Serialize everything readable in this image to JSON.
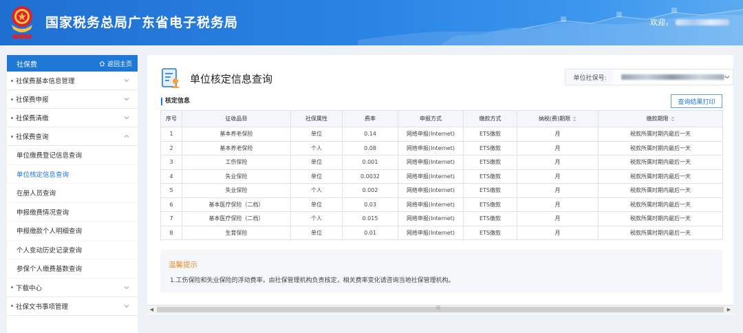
{
  "header": {
    "title": "国家税务总局广东省电子税务局",
    "welcome": "欢迎，"
  },
  "sidebar": {
    "title": "社保费",
    "home_link": "返回主页",
    "groups_top": [
      {
        "label": "社保费基本信息管理",
        "expanded": false
      },
      {
        "label": "社保费申报",
        "expanded": false
      },
      {
        "label": "社保费清缴",
        "expanded": false
      },
      {
        "label": "社保费查询",
        "expanded": true
      }
    ],
    "sub_items": [
      {
        "label": "单位缴费登记信息查询",
        "active": false
      },
      {
        "label": "单位核定信息查询",
        "active": true
      },
      {
        "label": "在册人员查询",
        "active": false
      },
      {
        "label": "申报缴费情况查询",
        "active": false
      },
      {
        "label": "申报缴款个人明细查询",
        "active": false
      },
      {
        "label": "个人变动历史记录查询",
        "active": false
      },
      {
        "label": "参保个人缴费基数查询",
        "active": false
      }
    ],
    "groups_bottom": [
      {
        "label": "下载中心",
        "expanded": false
      },
      {
        "label": "社保文书事项管理",
        "expanded": false
      }
    ]
  },
  "main": {
    "page_title": "单位核定信息查询",
    "ssn_label": "单位社保号:",
    "print_button": "查询结果打印",
    "section_label": "核定信息",
    "table": {
      "columns": [
        "序号",
        "征收品目",
        "社保属性",
        "费率",
        "申报方式",
        "缴款方式",
        "纳税(费)期限",
        "缴款期限"
      ],
      "rows": [
        [
          "1",
          "基本养老保险",
          "单位",
          "0.14",
          "网络申报(Internet)",
          "ETS缴款",
          "月",
          "税款所属时期内最后一天"
        ],
        [
          "2",
          "基本养老保险",
          "个人",
          "0.08",
          "网络申报(Internet)",
          "ETS缴款",
          "月",
          "税款所属时期内最后一天"
        ],
        [
          "3",
          "工伤保险",
          "单位",
          "0.001",
          "网络申报(Internet)",
          "ETS缴款",
          "月",
          "税款所属时期内最后一天"
        ],
        [
          "4",
          "失业保险",
          "单位",
          "0.0032",
          "网络申报(Internet)",
          "ETS缴款",
          "月",
          "税款所属时期内最后一天"
        ],
        [
          "5",
          "失业保险",
          "个人",
          "0.002",
          "网络申报(Internet)",
          "ETS缴款",
          "月",
          "税款所属时期内最后一天"
        ],
        [
          "6",
          "基本医疗保险（二档）",
          "单位",
          "0.03",
          "网络申报(Internet)",
          "ETS缴款",
          "月",
          "税款所属时期内最后一天"
        ],
        [
          "7",
          "基本医疗保险（二档）",
          "个人",
          "0.015",
          "网络申报(Internet)",
          "ETS缴款",
          "月",
          "税款所属时期内最后一天"
        ],
        [
          "8",
          "生育保险",
          "单位",
          "0.01",
          "网络申报(Internet)",
          "ETS缴款",
          "月",
          "税款所属时期内最后一天"
        ]
      ]
    },
    "tips": {
      "title": "温馨提示",
      "text": "1.工伤保险和失业保险的浮动费率，由社保管理机构负责核定，相关费率变化请咨询当地社保管理机构。"
    }
  },
  "colors": {
    "header_blue": "#2a84e4",
    "accent": "#1f78d6",
    "tips_title": "#e8902b"
  }
}
